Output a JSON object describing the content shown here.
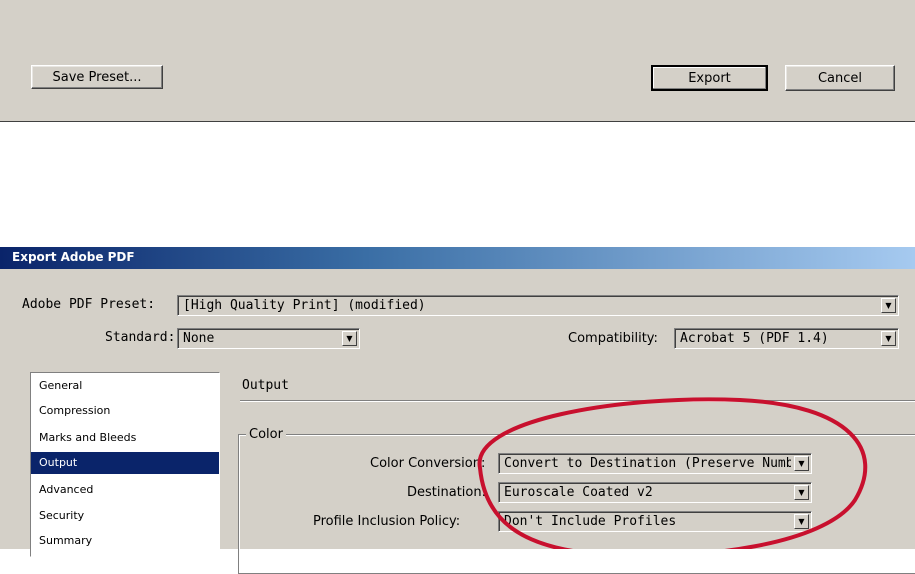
{
  "top": {
    "save_preset": "Save Preset...",
    "export": "Export",
    "cancel": "Cancel"
  },
  "dialog": {
    "title": "Export Adobe PDF",
    "preset_label": "Adobe PDF Preset:",
    "preset_value": "[High Quality Print] (modified)",
    "standard_label": "Standard:",
    "standard_value": "None",
    "compat_label": "Compatibility:",
    "compat_value": "Acrobat 5 (PDF 1.4)",
    "nav": [
      "General",
      "Compression",
      "Marks and Bleeds",
      "Output",
      "Advanced",
      "Security",
      "Summary"
    ],
    "selected_nav": "Output",
    "section_title": "Output",
    "group_title": "Color",
    "color_conversion_label": "Color Conversion:",
    "color_conversion_value": "Convert to Destination (Preserve Numb",
    "destination_label": "Destination:",
    "destination_value": "Euroscale Coated v2",
    "profile_label": "Profile Inclusion Policy:",
    "profile_value": "Don't Include Profiles"
  },
  "annotation": {
    "color": "#c8102e",
    "shape": "hand-drawn ellipse"
  },
  "colors": {
    "title_start": "#0a246a",
    "title_end": "#a6caf0",
    "selection": "#0a246a",
    "face": "#d4d0c8"
  }
}
